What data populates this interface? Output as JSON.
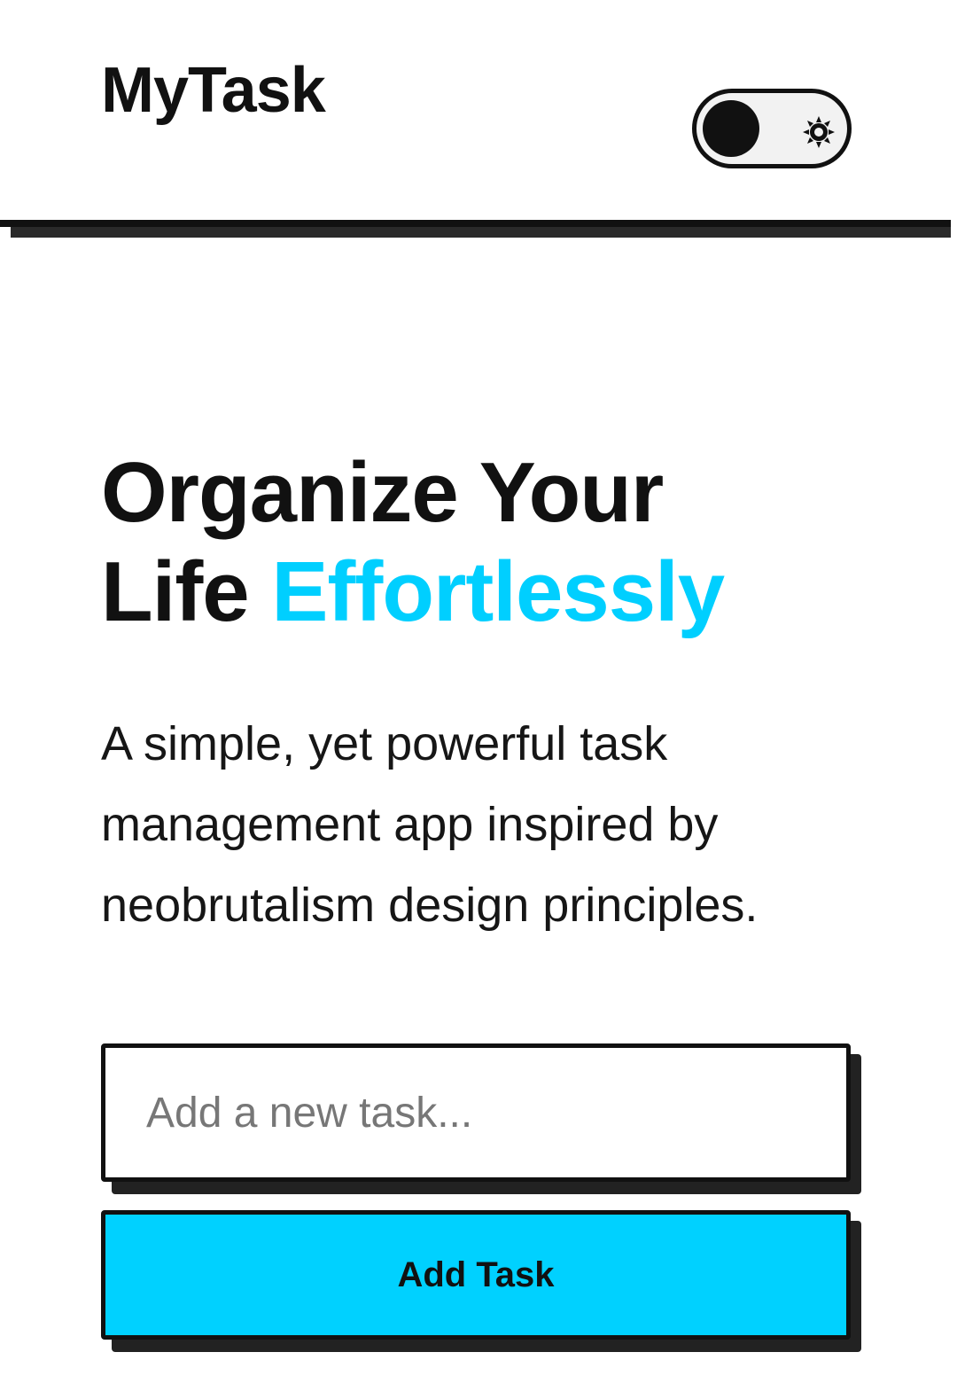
{
  "header": {
    "logo": "MyTask",
    "theme_toggle": {
      "state": "light",
      "icon": "sun-icon"
    }
  },
  "hero": {
    "title_part1": "Organize Your",
    "title_part2": "Life",
    "title_accent": "Effortlessly",
    "description": "A simple, yet powerful task management app inspired by neobrutalism design principles."
  },
  "task_form": {
    "input_value": "",
    "input_placeholder": "Add a new task...",
    "submit_label": "Add Task"
  },
  "colors": {
    "accent": "#00cfff",
    "button": "#00d1ff",
    "ink": "#111111",
    "background": "#ffffff"
  }
}
